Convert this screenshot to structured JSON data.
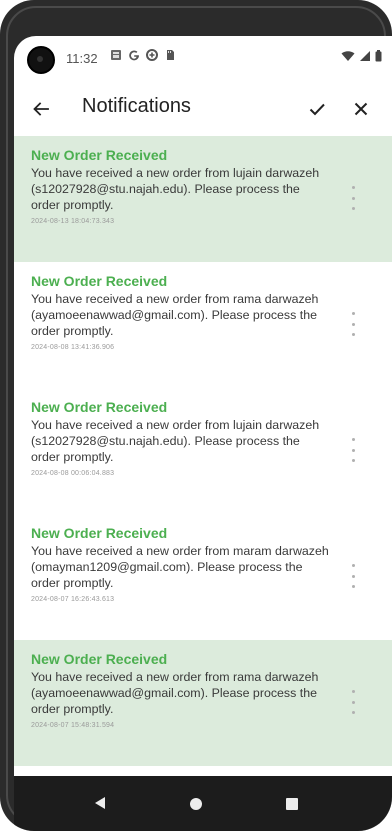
{
  "status_bar": {
    "time": "11:32",
    "icons": [
      "gallery-icon",
      "google-icon",
      "data-saver-icon",
      "sd-card-icon"
    ],
    "right_icons": [
      "wifi-icon",
      "signal-icon",
      "battery-icon"
    ]
  },
  "app_bar": {
    "title": "Notifications",
    "back_icon": "arrow-back-icon",
    "check_icon": "check-icon",
    "close_icon": "close-icon"
  },
  "colors": {
    "unread_background": "#dcebdc",
    "title_green": "#4caf50"
  },
  "notifications": [
    {
      "title": "New Order Received",
      "body": "You have received a new order from lujain darwazeh (s12027928@stu.najah.edu). Please process the order promptly.",
      "timestamp": "2024-08-13 18:04:73.343",
      "unread": true
    },
    {
      "title": "New Order Received",
      "body": "You have received a new order from rama darwazeh (ayamoeenawwad@gmail.com). Please process the order promptly.",
      "timestamp": "2024-08-08 13:41:36.906",
      "unread": false
    },
    {
      "title": "New Order Received",
      "body": "You have received a new order from lujain darwazeh (s12027928@stu.najah.edu). Please process the order promptly.",
      "timestamp": "2024-08-08 00:06:04.883",
      "unread": false
    },
    {
      "title": "New Order Received",
      "body": "You have received a new order from maram darwazeh (omayman1209@gmail.com). Please process the order promptly.",
      "timestamp": "2024-08-07 16:26:43.613",
      "unread": false
    },
    {
      "title": "New Order Received",
      "body": "You have received a new order from rama darwazeh (ayamoeenawwad@gmail.com). Please process the order promptly.",
      "timestamp": "2024-08-07 15:48:31.594",
      "unread": true
    }
  ],
  "nav_bar": {
    "back_icon": "triangle-back-icon",
    "home_icon": "circle-home-icon",
    "recents_icon": "square-recents-icon"
  }
}
